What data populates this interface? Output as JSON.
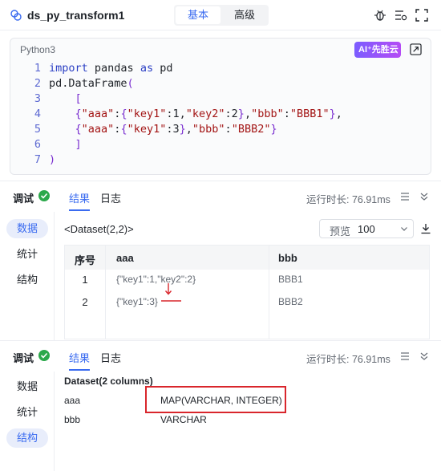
{
  "header": {
    "title": "ds_py_transform1",
    "mode_tabs": [
      "基本",
      "高级"
    ]
  },
  "editor": {
    "language": "Python3",
    "ai_badge": "AI⁺先胜云",
    "lines": [
      {
        "num": "1",
        "html": "<span class='kw'>import</span> pandas <span class='kw'>as</span> pd"
      },
      {
        "num": "2",
        "html": "pd.DataFrame<span class='br'>(</span>"
      },
      {
        "num": "3",
        "html": "    <span class='br'>[</span>"
      },
      {
        "num": "4",
        "html": "    <span class='br'>{</span><span class='str'>\"aaa\"</span>:<span class='br'>{</span><span class='str'>\"key1\"</span>:1,<span class='str'>\"key2\"</span>:2<span class='br'>}</span>,<span class='str'>\"bbb\"</span>:<span class='str'>\"BBB1\"</span><span class='br'>}</span>,"
      },
      {
        "num": "5",
        "html": "    <span class='br'>{</span><span class='str'>\"aaa\"</span>:<span class='br'>{</span><span class='str'>\"key1\"</span>:3<span class='br'>}</span>,<span class='str'>\"bbb\"</span>:<span class='str'>\"BBB2\"</span><span class='br'>}</span>"
      },
      {
        "num": "6",
        "html": "    <span class='br'>]</span>"
      },
      {
        "num": "7",
        "html": "<span class='br'>)</span>"
      }
    ],
    "lines_text": [
      "import pandas as pd",
      "pd.DataFrame(",
      "[",
      "{\"aaa\":{\"key1\":1,\"key2\":2},\"bbb\":\"BBB1\"},",
      "{\"aaa\":{\"key1\":3},\"bbb\":\"BBB2\"}",
      "]",
      ")"
    ]
  },
  "panel1": {
    "title": "调试",
    "tabs": [
      "结果",
      "日志"
    ],
    "runtime": "运行时长: 76.91ms",
    "side_items": [
      "数据",
      "统计",
      "结构"
    ],
    "active_side": 0
  },
  "result": {
    "dataset_label": "<Dataset(2,2)>",
    "preview_label": "预览",
    "preview_value": "100",
    "columns": [
      "序号",
      "aaa",
      "bbb"
    ],
    "rows": [
      [
        "1",
        "{\"key1\":1,\"key2\":2}",
        "BBB1"
      ],
      [
        "2",
        "{\"key1\":3}",
        "BBB2"
      ]
    ]
  },
  "panel2": {
    "title": "调试",
    "tabs": [
      "结果",
      "日志"
    ],
    "runtime": "运行时长: 76.91ms",
    "side_items": [
      "数据",
      "统计",
      "结构"
    ],
    "active_side": 2
  },
  "schema": {
    "title": "Dataset(2 columns)",
    "rows": [
      {
        "name": "aaa",
        "type": "MAP(VARCHAR, INTEGER)"
      },
      {
        "name": "bbb",
        "type": "VARCHAR"
      }
    ]
  },
  "colors": {
    "accent": "#3a6bf0",
    "success": "#2ba84a",
    "highlight": "#d9262c"
  }
}
